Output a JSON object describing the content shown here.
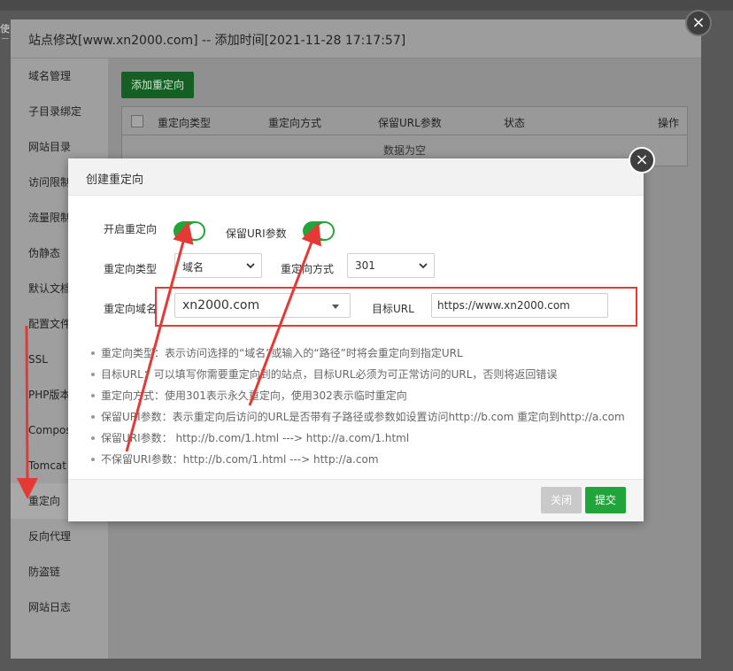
{
  "background": {
    "fragment": "使用"
  },
  "outer_modal": {
    "title": "站点修改[www.xn2000.com] -- 添加时间[2021-11-28 17:17:57]",
    "close_icon": "×",
    "sidebar": [
      {
        "label": "域名管理"
      },
      {
        "label": "子目录绑定"
      },
      {
        "label": "网站目录"
      },
      {
        "label": "访问限制"
      },
      {
        "label": "流量限制"
      },
      {
        "label": "伪静态"
      },
      {
        "label": "默认文档"
      },
      {
        "label": "配置文件"
      },
      {
        "label": "SSL"
      },
      {
        "label": "PHP版本"
      },
      {
        "label": "Composer"
      },
      {
        "label": "Tomcat"
      },
      {
        "label": "重定向"
      },
      {
        "label": "反向代理"
      },
      {
        "label": "防盗链"
      },
      {
        "label": "网站日志"
      }
    ],
    "active_sidebar": "重定向",
    "add_button": "添加重定向",
    "table": {
      "headers": [
        "重定向类型",
        "重定向方式",
        "保留URL参数",
        "状态",
        "操作"
      ],
      "empty_text": "数据为空"
    }
  },
  "dialog": {
    "title": "创建重定向",
    "close_icon": "×",
    "enable_label": "开启重定向",
    "enable_on": true,
    "keep_uri_label": "保留URI参数",
    "keep_uri_on": true,
    "type_label": "重定向类型",
    "type_value": "域名",
    "method_label": "重定向方式",
    "method_value": "301",
    "domain_label": "重定向域名",
    "domain_value": "xn2000.com",
    "target_label": "目标URL",
    "target_value": "https://www.xn2000.com",
    "notes": [
      "重定向类型：表示访问选择的“域名”或输入的“路径”时将会重定向到指定URL",
      "目标URL：可以填写你需要重定向到的站点，目标URL必须为可正常访问的URL，否则将返回错误",
      "重定向方式：使用301表示永久重定向，使用302表示临时重定向",
      "保留URI参数：表示重定向后访问的URL是否带有子路径或参数如设置访问http://b.com 重定向到http://a.com",
      "保留URI参数： http://b.com/1.html ---> http://a.com/1.html",
      "不保留URI参数：http://b.com/1.html ---> http://a.com"
    ],
    "close_button": "关闭",
    "submit_button": "提交"
  },
  "annotation_color": "#e53935",
  "accent_color": "#20a53a"
}
